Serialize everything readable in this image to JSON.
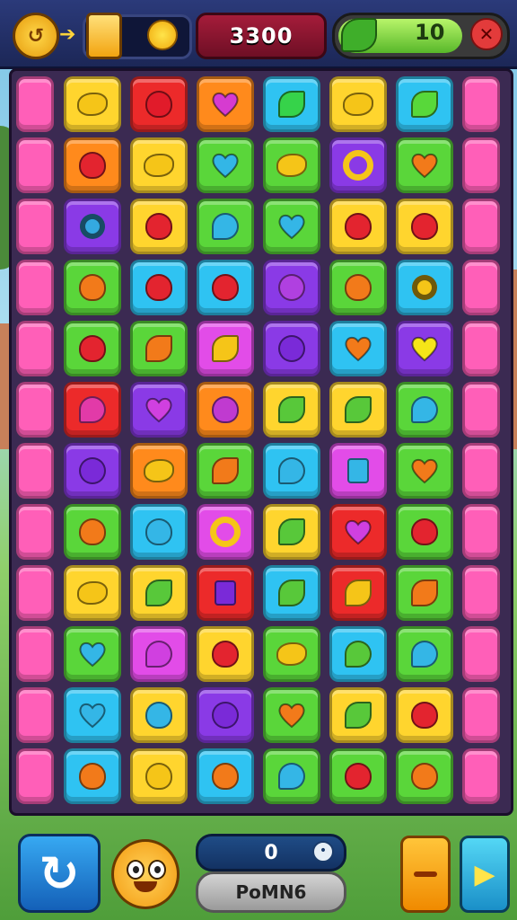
{
  "header": {
    "coin_icon": "coin-swap-icon",
    "score": "3300",
    "moves": "10",
    "close_icon": "close-icon",
    "moves_fill_percent": 75
  },
  "board": {
    "rows": [
      [
        "pink",
        "yellow:lemon:#f5c518",
        "red:apple:#e11b2a",
        "orange:heart:#d63bd0",
        "cyan:leaf:#36d34a",
        "yellow:lemon:#f5c518",
        "cyan:leaf:#58d83a",
        "pink"
      ],
      [
        "pink",
        "orange:apple:#e3242f",
        "yellow:lemon:#f5c518",
        "green:heart:#33b6e6",
        "green:lemon:#f5c518",
        "purple:ring:#f5c518",
        "green:heart:#f27a1a",
        "pink"
      ],
      [
        "pink",
        "purple:swirl:#34a9e0",
        "yellow:apple:#e3242f",
        "green:bubble:#34b6e6",
        "green:heart:#34b6e6",
        "yellow:apple:#e3242f",
        "yellow:apple:#e3242f",
        "pink"
      ],
      [
        "pink",
        "green:apple:#f27a1a",
        "cyan:apple:#e3242f",
        "cyan:apple:#e3242f",
        "purple:clock:#b040e0",
        "green:apple:#f27a1a",
        "cyan:swirl:#f5c518",
        "pink"
      ],
      [
        "pink",
        "green:apple:#e3242f",
        "green:leaf:#f27a1a",
        "magenta:leaf:#f5c518",
        "purple:clock:#7a2ad8",
        "cyan:heart:#f27a1a",
        "purple:heart:#f5e518",
        "pink"
      ],
      [
        "pink",
        "red:bubble:#e23aa8",
        "purple:heart:#d040e0",
        "orange:apple:#c03ad0",
        "yellow:leaf:#58c83a",
        "yellow:leaf:#58c83a",
        "green:bubble:#34b6e6",
        "pink"
      ],
      [
        "pink",
        "purple:clock:#7a2ad8",
        "orange:lemon:#f5c518",
        "green:leaf:#f27a1a",
        "cyan:bubble:#34b6e6",
        "magenta:square:#34b6e6",
        "green:heart:#f27a1a",
        "pink"
      ],
      [
        "pink",
        "green:apple:#f27a1a",
        "cyan:apple:#34b6e6",
        "magenta:ring:#f5c518",
        "yellow:leaf:#58c83a",
        "red:heart:#d040e0",
        "green:apple:#e3242f",
        "pink"
      ],
      [
        "pink",
        "yellow:lemon:#f5c518",
        "yellow:leaf:#58c83a",
        "red:square:#7a2ad8",
        "cyan:leaf:#58c83a",
        "red:leaf:#f5c518",
        "green:leaf:#f27a1a",
        "pink"
      ],
      [
        "pink",
        "green:heart:#34b6e6",
        "magenta:bubble:#d040e0",
        "yellow:apple:#e3242f",
        "green:lemon:#f5c518",
        "cyan:bubble:#58c83a",
        "green:bubble:#34b6e6",
        "pink"
      ],
      [
        "pink",
        "cyan:heart:#34b6e6",
        "yellow:apple:#34b6e6",
        "purple:clock:#7a2ad8",
        "green:heart:#f27a1a",
        "yellow:leaf:#58c83a",
        "yellow:apple:#e3242f",
        "pink"
      ],
      [
        "pink",
        "cyan:apple:#f27a1a",
        "yellow:apple:#f5c518",
        "cyan:apple:#f27a1a",
        "green:bubble:#34b6e6",
        "green:apple:#e3242f",
        "green:apple:#f27a1a",
        "pink"
      ]
    ]
  },
  "palette": {
    "pink": "#ff5fb8",
    "yellow": "#ffd52e",
    "red": "#ec2a2a",
    "orange": "#ff8a1c",
    "cyan": "#2fc3f2",
    "green": "#5ad63a",
    "purple": "#8a3ae6",
    "magenta": "#e24ce8"
  },
  "footer": {
    "restart_icon": "restart-arrow-icon",
    "mascot_icon": "mascot-icon",
    "counter": "0",
    "counter_icon": "info-icon",
    "label": "PoMN6",
    "minus_icon": "minus-icon",
    "play_icon": "play-icon"
  }
}
